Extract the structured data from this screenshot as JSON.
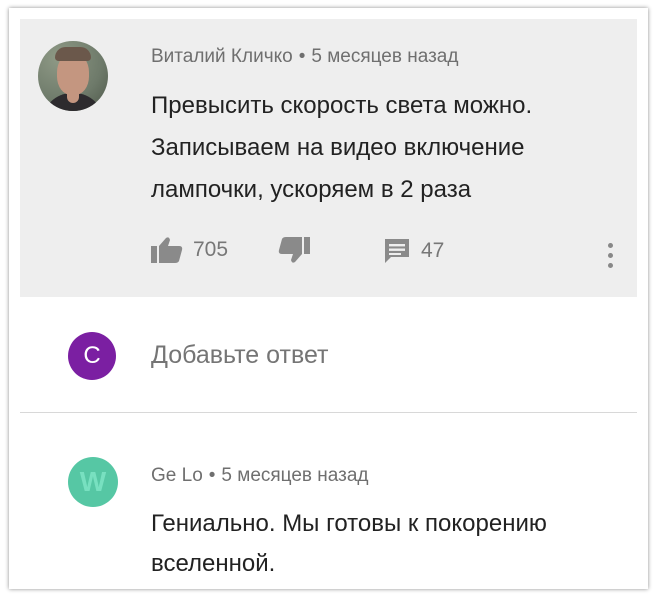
{
  "comment_main": {
    "author": "Виталий Кличко",
    "separator": "•",
    "time": "5 месяцев назад",
    "text": "Превысить скорость света можно. Записываем на видео включение лампочки, ускоряем в 2 раза",
    "likes": "705",
    "replies": "47",
    "icons": {
      "like": "thumb-up-icon",
      "dislike": "thumb-down-icon",
      "reply": "reply-icon",
      "more": "more-vert-icon"
    }
  },
  "reply_box": {
    "avatar_letter": "С",
    "avatar_color": "#7b1fa2",
    "placeholder": "Добавьте ответ"
  },
  "comment_second": {
    "avatar_letter": "W",
    "avatar_color": "#56c7a4",
    "author": "Ge Lo",
    "separator": "•",
    "time": "5 месяцев назад",
    "text": "Гениально. Мы готовы к покорению вселенной."
  }
}
